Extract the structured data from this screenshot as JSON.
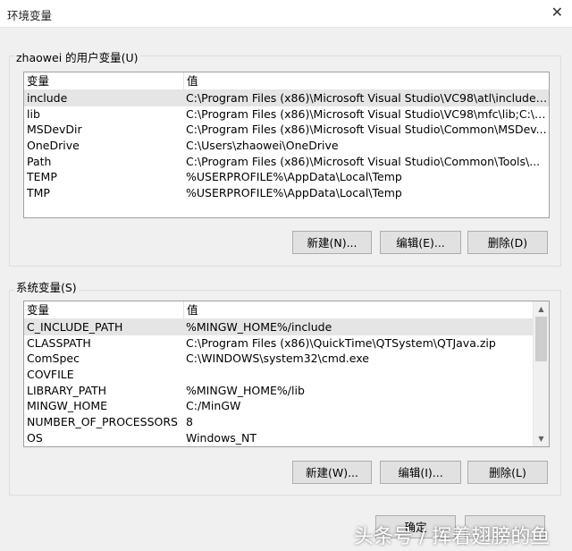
{
  "window": {
    "title": "环境变量",
    "close_glyph": "✕"
  },
  "user_vars": {
    "group_label": "zhaowei 的用户变量(U)",
    "col_var": "变量",
    "col_val": "值",
    "rows": [
      {
        "name": "include",
        "value": "C:\\Program Files (x86)\\Microsoft Visual Studio\\VC98\\atl\\include;..."
      },
      {
        "name": "lib",
        "value": "C:\\Program Files (x86)\\Microsoft Visual Studio\\VC98\\mfc\\lib;C:\\P..."
      },
      {
        "name": "MSDevDir",
        "value": "C:\\Program Files (x86)\\Microsoft Visual Studio\\Common\\MSDev..."
      },
      {
        "name": "OneDrive",
        "value": "C:\\Users\\zhaowei\\OneDrive"
      },
      {
        "name": "Path",
        "value": "C:\\Program Files (x86)\\Microsoft Visual Studio\\Common\\Tools\\..."
      },
      {
        "name": "TEMP",
        "value": "%USERPROFILE%\\AppData\\Local\\Temp"
      },
      {
        "name": "TMP",
        "value": "%USERPROFILE%\\AppData\\Local\\Temp"
      }
    ],
    "buttons": {
      "new": "新建(N)...",
      "edit": "编辑(E)...",
      "delete": "删除(D)"
    }
  },
  "system_vars": {
    "group_label": "系统变量(S)",
    "col_var": "变量",
    "col_val": "值",
    "rows": [
      {
        "name": "C_INCLUDE_PATH",
        "value": "%MINGW_HOME%/include"
      },
      {
        "name": "CLASSPATH",
        "value": "C:\\Program Files (x86)\\QuickTime\\QTSystem\\QTJava.zip"
      },
      {
        "name": "ComSpec",
        "value": "C:\\WINDOWS\\system32\\cmd.exe"
      },
      {
        "name": "COVFILE",
        "value": ""
      },
      {
        "name": "LIBRARY_PATH",
        "value": "%MINGW_HOME%/lib"
      },
      {
        "name": "MINGW_HOME",
        "value": "C:/MinGW"
      },
      {
        "name": "NUMBER_OF_PROCESSORS",
        "value": "8"
      },
      {
        "name": "OS",
        "value": "Windows_NT"
      }
    ],
    "buttons": {
      "new": "新建(W)...",
      "edit": "编辑(I)...",
      "delete": "删除(L)"
    }
  },
  "footer": {
    "ok": "确定",
    "watermark": "头条号 / 挥着翅膀的鱼"
  }
}
